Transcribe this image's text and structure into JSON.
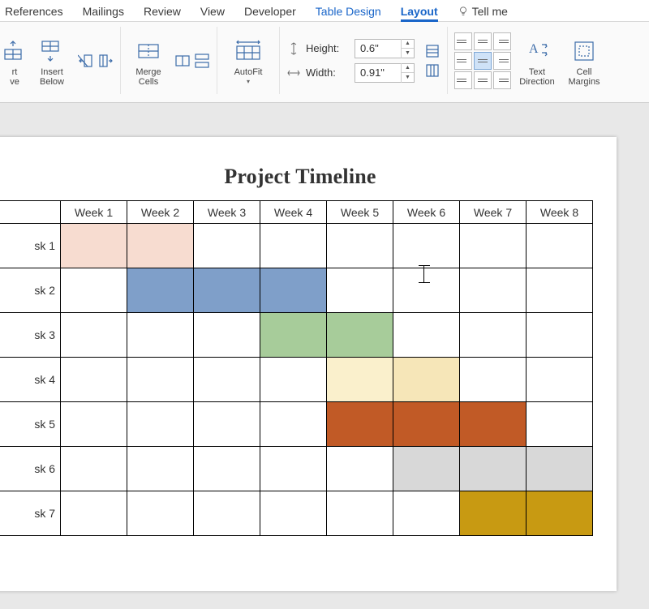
{
  "tabs": {
    "references": "References",
    "mailings": "Mailings",
    "review": "Review",
    "view": "View",
    "developer": "Developer",
    "table_design": "Table Design",
    "layout": "Layout",
    "tell_me": "Tell me"
  },
  "ribbon": {
    "insert_above_partial": "rt",
    "insert_above_partial2": "ve",
    "insert_below": "Insert",
    "insert_below2": "Below",
    "merge_cells": "Merge",
    "merge_cells2": "Cells",
    "autofit": "AutoFit",
    "height_label": "Height:",
    "height_value": "0.6\"",
    "width_label": "Width:",
    "width_value": "0.91\"",
    "text_direction": "Text",
    "text_direction2": "Direction",
    "cell_margins": "Cell",
    "cell_margins2": "Margins"
  },
  "document": {
    "title": "Project Timeline",
    "columns": [
      "Week 1",
      "Week 2",
      "Week 3",
      "Week 4",
      "Week 5",
      "Week 6",
      "Week 7",
      "Week 8"
    ],
    "rows": [
      "sk 1",
      "sk 2",
      "sk 3",
      "sk 4",
      "sk 5",
      "sk 6",
      "sk 7"
    ]
  },
  "colors": {
    "task1": "#f7dcd0",
    "task2": "#7f9fc9",
    "task3": "#a7cc9a",
    "task4": "#f6e6b8",
    "task4_light": "#faf0cc",
    "task5": "#c15a26",
    "task6": "#d8d8d8",
    "task7": "#c89a12"
  },
  "chart_data": {
    "type": "bar",
    "title": "Project Timeline",
    "categories": [
      "Week 1",
      "Week 2",
      "Week 3",
      "Week 4",
      "Week 5",
      "Week 6",
      "Week 7",
      "Week 8"
    ],
    "series": [
      {
        "name": "sk 1",
        "start": 1,
        "end": 2,
        "color": "#f7dcd0"
      },
      {
        "name": "sk 2",
        "start": 2,
        "end": 4,
        "color": "#7f9fc9"
      },
      {
        "name": "sk 3",
        "start": 4,
        "end": 5,
        "color": "#a7cc9a"
      },
      {
        "name": "sk 4",
        "start": 5,
        "end": 6,
        "color": "#f6e6b8"
      },
      {
        "name": "sk 5",
        "start": 5,
        "end": 7,
        "color": "#c15a26"
      },
      {
        "name": "sk 6",
        "start": 6,
        "end": 8,
        "color": "#d8d8d8"
      },
      {
        "name": "sk 7",
        "start": 7,
        "end": 8,
        "color": "#c89a12"
      }
    ],
    "xlabel": "",
    "ylabel": ""
  }
}
